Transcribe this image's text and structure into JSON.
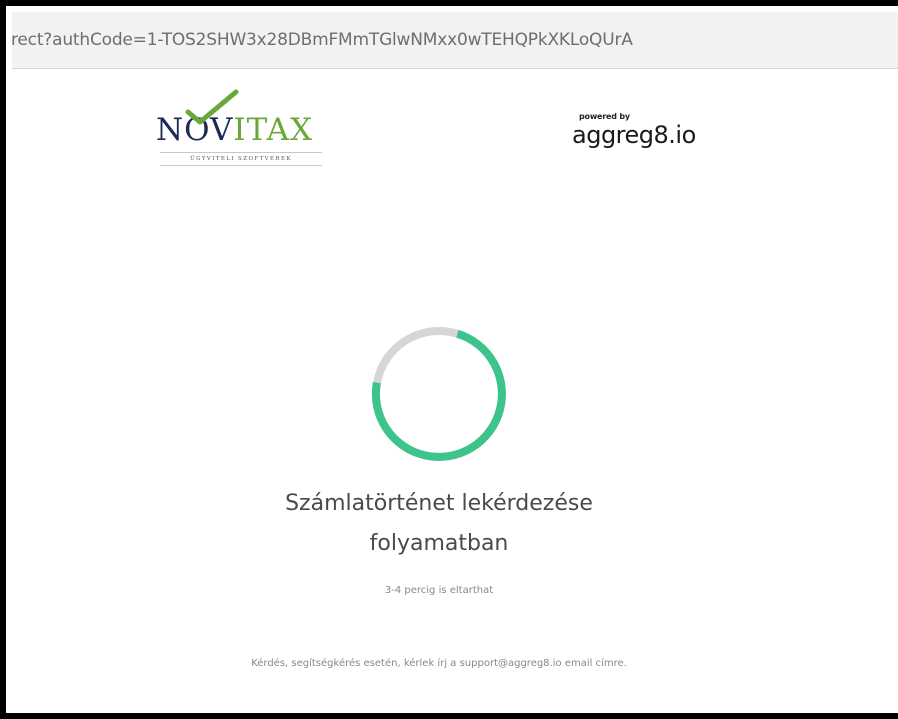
{
  "browser": {
    "url": "rect?authCode=1-TOS2SHW3x28DBmFMmTGlwNMxx0wTEHQPkXKLoQUrA"
  },
  "novitax_logo": {
    "word_dark_1": "N",
    "word_dark_2": "V",
    "word_green": "ITAX",
    "tagline": "ÜGYVITELI SZOFTVEREK",
    "colors": {
      "dark": "#1b2a57",
      "green": "#6aa83c"
    }
  },
  "aggreg_logo": {
    "powered_by": "powered by",
    "name": "aggreg8.io"
  },
  "loader": {
    "colors": {
      "track": "#d6d6d6",
      "progress": "#3cc48a"
    }
  },
  "status": {
    "title_line1": "Számlatörténet lekérdezése",
    "title_line2": "folyamatban",
    "subtitle": "3-4 percig is eltarthat"
  },
  "footer": {
    "support": "Kérdés, segítségkérés esetén, kérlek írj a support@aggreg8.io email címre."
  }
}
